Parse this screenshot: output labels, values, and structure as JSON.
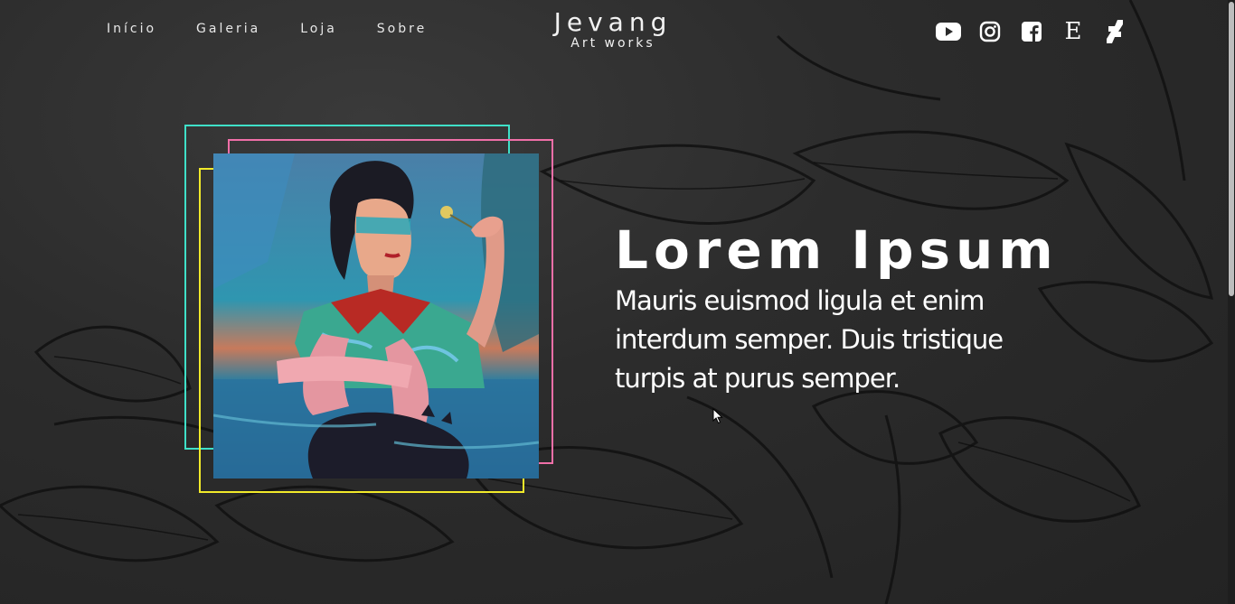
{
  "brand": {
    "name": "Jevang",
    "subtitle": "Art works"
  },
  "nav": {
    "links": [
      {
        "label": "Início"
      },
      {
        "label": "Galeria"
      },
      {
        "label": "Loja"
      },
      {
        "label": "Sobre"
      }
    ]
  },
  "social": {
    "icons": [
      "youtube-icon",
      "instagram-icon",
      "facebook-icon",
      "etsy-icon",
      "deviantart-icon"
    ],
    "etsy_glyph": "E"
  },
  "hero": {
    "title": "Lorem Ipsum",
    "text": "Mauris euismod ligula et enim interdum semper. Duis tristique turpis at purus semper."
  },
  "colors": {
    "frame_teal": "#3fe0c8",
    "frame_pink": "#f06fa8",
    "frame_yellow": "#f2ea2a",
    "background": "#2a2a2a",
    "text": "#ffffff"
  }
}
